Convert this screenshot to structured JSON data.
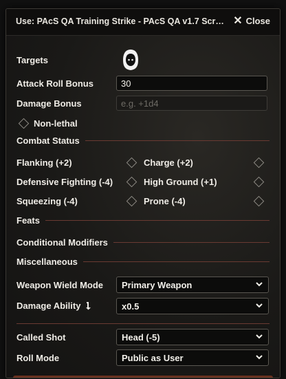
{
  "window": {
    "title": "Use: PAcS QA Training Strike - PAcS QA v1.7 Scre...",
    "close_label": "Close"
  },
  "targets": {
    "label": "Targets",
    "avatar_icon": "hooded-figure-icon"
  },
  "attack_roll_bonus": {
    "label": "Attack Roll Bonus",
    "value": "30"
  },
  "damage_bonus": {
    "label": "Damage Bonus",
    "placeholder": "e.g. +1d4"
  },
  "non_lethal": {
    "label": "Non-lethal",
    "checked": false
  },
  "combat_status": {
    "heading": "Combat Status",
    "options": [
      {
        "label": "Flanking (+2)",
        "checked": false
      },
      {
        "label": "Charge (+2)",
        "checked": false
      },
      {
        "label": "Defensive Fighting (-4)",
        "checked": false
      },
      {
        "label": "High Ground (+1)",
        "checked": false
      },
      {
        "label": "Squeezing (-4)",
        "checked": false
      },
      {
        "label": "Prone (-4)",
        "checked": false
      }
    ]
  },
  "sections": {
    "feats": "Feats",
    "conditional_modifiers": "Conditional Modifiers",
    "miscellaneous": "Miscellaneous"
  },
  "weapon_wield_mode": {
    "label": "Weapon Wield Mode",
    "value": "Primary Weapon"
  },
  "damage_ability": {
    "label": "Damage Ability",
    "icon": "arrow-down-icon",
    "value": "x0.5"
  },
  "called_shot": {
    "label": "Called Shot",
    "value": "Head (-5)"
  },
  "roll_mode": {
    "label": "Roll Mode",
    "value": "Public as User"
  },
  "colors": {
    "accent_rule": "#6a3a32",
    "panel_bg": "#1c1a18",
    "input_bg": "#0c0c0b"
  }
}
